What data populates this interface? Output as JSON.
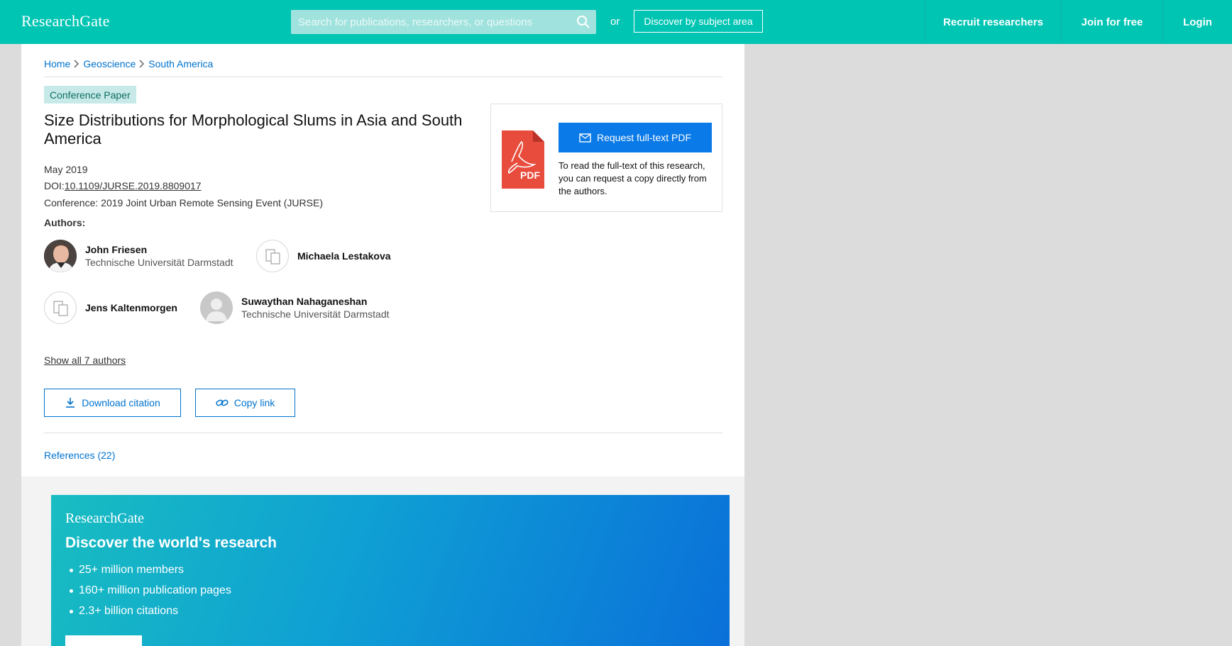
{
  "header": {
    "logo": "ResearchGate",
    "search_placeholder": "Search for publications, researchers, or questions",
    "or_text": "or",
    "discover_label": "Discover by subject area",
    "nav": {
      "recruit": "Recruit researchers",
      "join": "Join for free",
      "login": "Login"
    }
  },
  "breadcrumb": [
    "Home",
    "Geoscience",
    "South America"
  ],
  "paper": {
    "type_badge": "Conference Paper",
    "title": "Size Distributions for Morphological Slums in Asia and South America",
    "date": "May 2019",
    "doi_label": "DOI:",
    "doi": "10.1109/JURSE.2019.8809017",
    "conference": "Conference: 2019 Joint Urban Remote Sensing Event (JURSE)",
    "authors_label": "Authors:",
    "authors": [
      {
        "name": "John Friesen",
        "institution": "Technische Universität Darmstadt",
        "avatar": "photo"
      },
      {
        "name": "Michaela Lestakova",
        "institution": "",
        "avatar": "placeholder"
      },
      {
        "name": "Jens Kaltenmorgen",
        "institution": "",
        "avatar": "placeholder"
      },
      {
        "name": "Suwaythan Nahaganeshan",
        "institution": "Technische Universität Darmstadt",
        "avatar": "default-user"
      }
    ],
    "show_all": "Show all 7 authors",
    "download_citation": "Download citation",
    "copy_link": "Copy link",
    "references": "References (22)"
  },
  "pdf": {
    "icon_label": "PDF",
    "request_label": "Request full-text PDF",
    "note": "To read the full-text of this research, you can request a copy directly from the authors."
  },
  "promo": {
    "logo": "ResearchGate",
    "headline": "Discover the world's research",
    "bullets": [
      "25+ million members",
      "160+ million publication pages",
      "2.3+ billion citations"
    ]
  },
  "colors": {
    "brand_teal": "#00c5b3",
    "link_blue": "#0073ce",
    "button_blue": "#0a7ae8",
    "pdf_red": "#e84c3d"
  }
}
